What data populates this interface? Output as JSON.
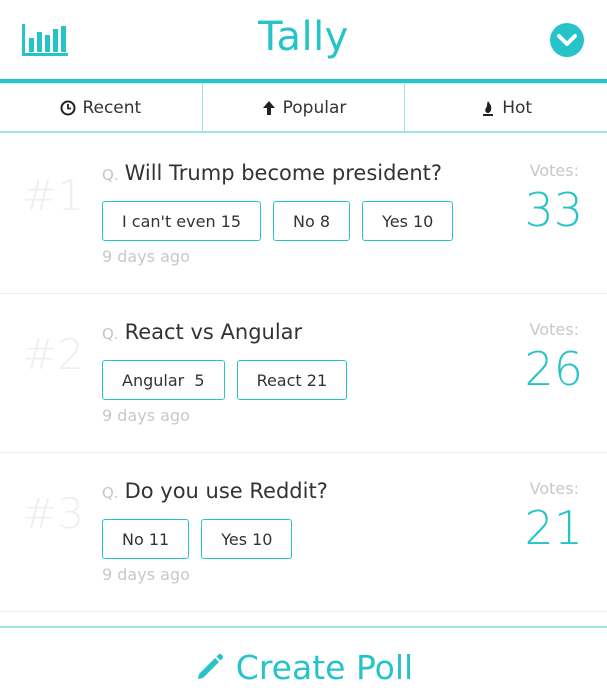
{
  "header": {
    "title": "Tally",
    "logo_icon": "bar-chart-icon",
    "menu_icon": "chevron-down-circle-icon",
    "accent_color": "#26c3c8"
  },
  "tabs": [
    {
      "label": "Recent",
      "icon": "clock-icon"
    },
    {
      "label": "Popular",
      "icon": "arrow-up-icon"
    },
    {
      "label": "Hot",
      "icon": "flame-icon"
    }
  ],
  "polls": [
    {
      "rank": "#1",
      "q_prefix": "Q.",
      "question": "Will Trump become president?",
      "options": [
        "I can't even 15",
        "No 8",
        "Yes 10"
      ],
      "time": "9 days ago",
      "votes_label": "Votes:",
      "votes": "33"
    },
    {
      "rank": "#2",
      "q_prefix": "Q.",
      "question": "React vs Angular",
      "options": [
        "Angular  5",
        "React 21"
      ],
      "time": "9 days ago",
      "votes_label": "Votes:",
      "votes": "26"
    },
    {
      "rank": "#3",
      "q_prefix": "Q.",
      "question": "Do you use Reddit?",
      "options": [
        "No 11",
        "Yes 10"
      ],
      "time": "9 days ago",
      "votes_label": "Votes:",
      "votes": "21"
    }
  ],
  "footer": {
    "create_label": "Create Poll",
    "create_icon": "pencil-icon"
  }
}
